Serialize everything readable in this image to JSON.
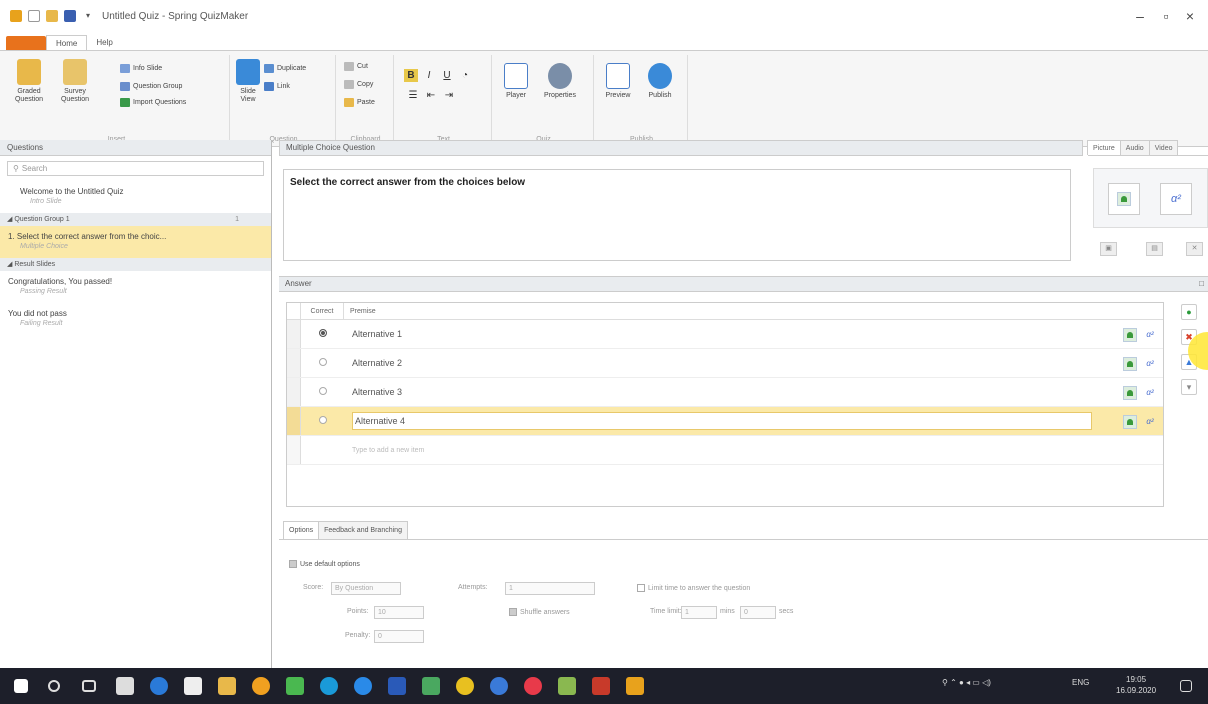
{
  "window": {
    "title": "Untitled Quiz - Spring QuizMaker",
    "minimize": "–",
    "maximize": "▫",
    "close": "×"
  },
  "ribbon": {
    "file_label": "",
    "tabs": [
      "Home",
      "Help"
    ],
    "insert": {
      "graded_question": "Graded Question",
      "survey_question": "Survey Question",
      "info_slide": "Info Slide",
      "question_group": "Question Group",
      "import_questions": "Import Questions",
      "label": "Insert"
    },
    "question": {
      "slide_view": "Slide View",
      "duplicate": "Duplicate",
      "link": "Link",
      "label": "Question"
    },
    "clipboard": {
      "cut": "Cut",
      "copy": "Copy",
      "paste": "Paste",
      "label": "Clipboard"
    },
    "text": {
      "label": "Text"
    },
    "quiz": {
      "player": "Player",
      "properties": "Properties",
      "label": "Quiz"
    },
    "publish": {
      "preview": "Preview",
      "publish": "Publish",
      "label": "Publish"
    }
  },
  "left_panel": {
    "header": "Questions",
    "search_placeholder": "Search",
    "intro": {
      "title": "Welcome to the Untitled Quiz",
      "sub": "Intro Slide"
    },
    "group1": {
      "label": "Question Group 1",
      "count": "1"
    },
    "selected_question": {
      "title": "1. Select the correct answer from the choic...",
      "sub": "Multiple Choice"
    },
    "result_group": {
      "label": "Result Slides"
    },
    "passed": {
      "title": "Congratulations, You passed!",
      "sub": "Passing Result"
    },
    "failed": {
      "title": "You did not pass",
      "sub": "Failing Result"
    }
  },
  "question": {
    "header": "Multiple Choice Question",
    "text": "Select the correct answer from the choices below"
  },
  "answer": {
    "header": "Answer",
    "col_correct": "Correct",
    "col_premise": "Premise",
    "rows": [
      {
        "text": "Alternative 1",
        "correct": true
      },
      {
        "text": "Alternative 2",
        "correct": false
      },
      {
        "text": "Alternative 3",
        "correct": false
      },
      {
        "text": "Alternative 4",
        "correct": false
      }
    ],
    "new_item_placeholder": "Type to add a new item"
  },
  "media": {
    "tabs": [
      "Picture",
      "Audio",
      "Video"
    ]
  },
  "options": {
    "tabs": [
      "Options",
      "Feedback and Branching"
    ],
    "use_default": "Use default options",
    "score_label": "Score:",
    "score_value": "By Question",
    "attempts_label": "Attempts:",
    "attempts_value": "1",
    "limit_time": "Limit time to answer the question",
    "points_label": "Points:",
    "points_value": "10",
    "shuffle": "Shuffle answers",
    "time_limit_label": "Time limit:",
    "time_min": "1",
    "min_label": "mins",
    "time_sec": "0",
    "sec_label": "secs",
    "penalty_label": "Penalty:",
    "penalty_value": "0"
  },
  "taskbar": {
    "lang": "ENG",
    "time": "19:05",
    "date": "16.09.2020"
  }
}
